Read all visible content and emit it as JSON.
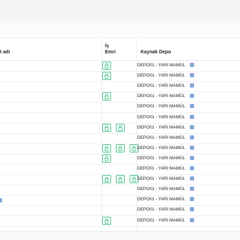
{
  "table": {
    "columns": {
      "name_partial": "t adı",
      "work_order_line1": "İş",
      "work_order_line2": "Emri",
      "source_warehouse": "Kaynak Depo"
    },
    "rows": [
      {
        "source": "DEPO01 - YARI MAMÜL",
        "locks": 1
      },
      {
        "source": "DEPO01 - YARI MAMÜL",
        "locks": 1
      },
      {
        "source": "DEPO01 - YARI MAMÜL",
        "locks": 0
      },
      {
        "source": "DEPO01 - YARI MAMÜL",
        "locks": 1
      },
      {
        "source": "DEPO01 - YARI MAMÜL",
        "locks": 0
      },
      {
        "source": "DEPO01 - YARI MAMÜL",
        "locks": 0
      },
      {
        "source": "DEPO01 - YARI MAMÜL",
        "locks": 1
      },
      {
        "source": "DEPO01 - YARI MAMÜL",
        "locks": 0
      },
      {
        "source": "DEPO01 - YARI MAMÜL",
        "locks": 1
      },
      {
        "source": "DEPO01 - YARI MAMÜL",
        "locks": 1
      },
      {
        "source": "DEPO01 - YARI MAMÜL",
        "locks": 0
      },
      {
        "source": "DEPO01 - YARI MAMÜL",
        "locks": 1
      },
      {
        "source": "DEPO01 - YARI MAMÜL",
        "locks": 0
      },
      {
        "source": "DEPO01 - YARI MAMÜL",
        "locks": 0
      },
      {
        "source": "DEPO01 - YARI MAMÜL",
        "locks": 0
      },
      {
        "source": "DEPO01 - YARI MAMÜL",
        "locks": 1
      }
    ]
  },
  "colors": {
    "lock_border": "#4cc38a",
    "info_icon": "#7fa5d8"
  }
}
